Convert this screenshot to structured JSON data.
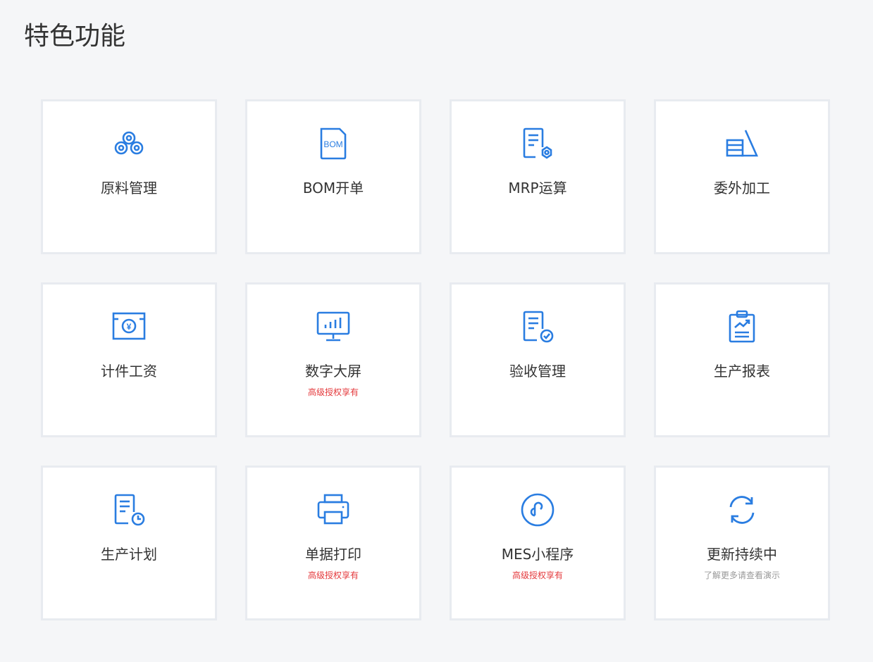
{
  "header": {
    "title": "特色功能"
  },
  "colors": {
    "accent": "#2a7de1",
    "premium": "#e4393c",
    "muted": "#999999"
  },
  "features": [
    {
      "label": "原料管理",
      "icon": "gears-icon",
      "sub": ""
    },
    {
      "label": "BOM开单",
      "icon": "bom-doc-icon",
      "icon_text": "BOM",
      "sub": ""
    },
    {
      "label": "MRP运算",
      "icon": "doc-gear-icon",
      "sub": ""
    },
    {
      "label": "委外加工",
      "icon": "outsource-icon",
      "sub": ""
    },
    {
      "label": "计件工资",
      "icon": "wage-icon",
      "icon_text": "¥",
      "sub": ""
    },
    {
      "label": "数字大屏",
      "icon": "monitor-chart-icon",
      "sub": "高级授权享有"
    },
    {
      "label": "验收管理",
      "icon": "doc-check-icon",
      "sub": ""
    },
    {
      "label": "生产报表",
      "icon": "clipboard-chart-icon",
      "sub": ""
    },
    {
      "label": "生产计划",
      "icon": "doc-clock-icon",
      "sub": ""
    },
    {
      "label": "单据打印",
      "icon": "printer-icon",
      "sub": "高级授权享有"
    },
    {
      "label": "MES小程序",
      "icon": "mini-program-icon",
      "sub": "高级授权享有"
    },
    {
      "label": "更新持续中",
      "icon": "refresh-icon",
      "sub": "了解更多请查看演示"
    }
  ]
}
